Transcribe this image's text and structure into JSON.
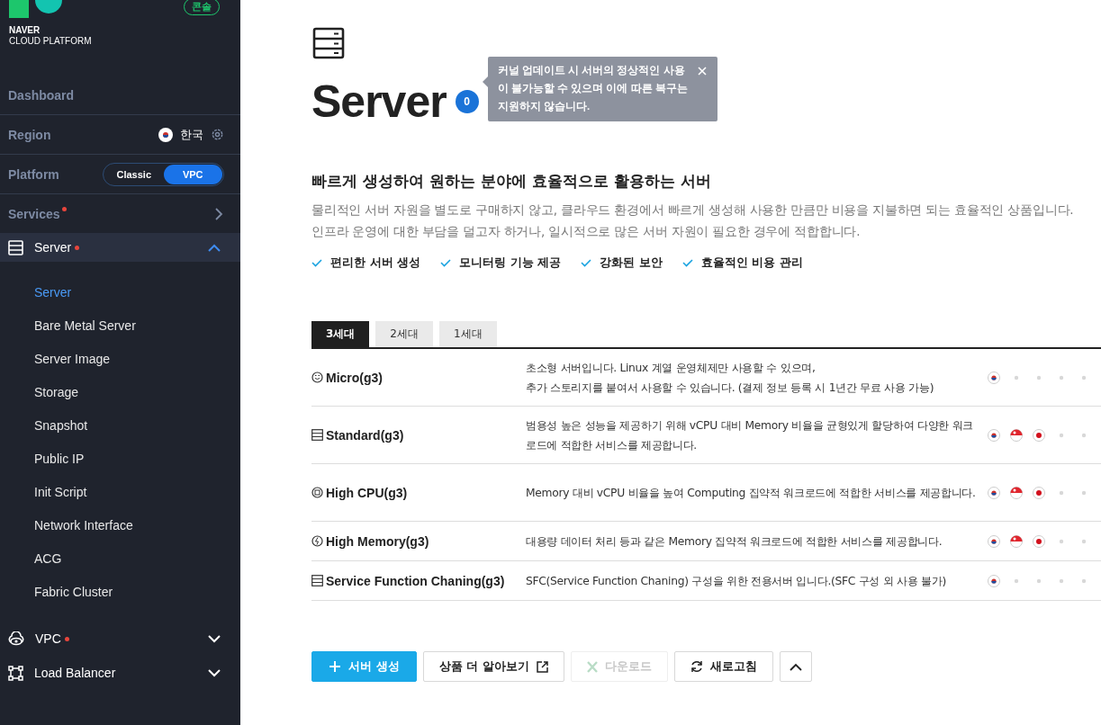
{
  "sidebar": {
    "logo": {
      "line1": "NAVER",
      "line2": "CLOUD PLATFORM"
    },
    "console_badge": "콘솔",
    "dashboard": "Dashboard",
    "region": {
      "label": "Region",
      "value": "한국"
    },
    "platform": {
      "label": "Platform",
      "options": [
        {
          "label": "Classic",
          "selected": false
        },
        {
          "label": "VPC",
          "selected": true
        }
      ]
    },
    "services": {
      "label": "Services",
      "new": true
    },
    "groups": [
      {
        "label": "Server",
        "kind": "server",
        "new": true,
        "expanded": true,
        "items": [
          {
            "label": "Server",
            "selected": true
          },
          {
            "label": "Bare Metal Server",
            "selected": false
          },
          {
            "label": "Server Image",
            "selected": false
          },
          {
            "label": "Storage",
            "selected": false
          },
          {
            "label": "Snapshot",
            "selected": false
          },
          {
            "label": "Public IP",
            "selected": false
          },
          {
            "label": "Init Script",
            "selected": false
          },
          {
            "label": "Network Interface",
            "selected": false
          },
          {
            "label": "ACG",
            "selected": false
          },
          {
            "label": "Fabric Cluster",
            "selected": false
          }
        ]
      },
      {
        "label": "VPC",
        "kind": "vpc",
        "new": true,
        "expanded": false
      },
      {
        "label": "Load Balancer",
        "kind": "lb",
        "new": false,
        "expanded": false
      }
    ]
  },
  "header": {
    "title": "Server",
    "badge": "0",
    "tooltip": "커널 업데이트 시 서버의 정상적인 사용이 불가능할 수 있으며 이에 따른 복구는 지원하지 않습니다."
  },
  "intro": {
    "heading": "빠르게 생성하여 원하는 분야에 효율적으로 활용하는 서버",
    "lines": [
      "물리적인 서버 자원을 별도로 구매하지 않고, 클라우드 환경에서 빠르게 생성해 사용한 만큼만 비용을 지불하면 되는 효율적인 상품입니다.",
      "인프라 운영에 대한 부담을 덜고자 하거나, 일시적으로 많은 서버 자원이 필요한 경우에 적합합니다."
    ],
    "features": [
      "편리한 서버 생성",
      "모니터링 기능 제공",
      "강화된 보안",
      "효율적인 비용 관리"
    ]
  },
  "tabs": [
    {
      "label": "3세대",
      "selected": true
    },
    {
      "label": "2세대",
      "selected": false
    },
    {
      "label": "1세대",
      "selected": false
    }
  ],
  "rows": [
    {
      "kind": "micro",
      "name": "Micro(g3)",
      "description": "초소형 서버입니다. Linux 계열 운영체제만 사용할 수 있으며,\n추가 스토리지를 붙여서 사용할 수 있습니다. (결제 정보 등록 시 1년간 무료 사용 가능)",
      "regions": [
        {
          "kind": "kr"
        },
        {
          "kind": "none"
        },
        {
          "kind": "none"
        },
        {
          "kind": "none"
        },
        {
          "kind": "none"
        }
      ]
    },
    {
      "kind": "standard",
      "name": "Standard(g3)",
      "description": "범용성 높은 성능을 제공하기 위해 vCPU 대비 Memory 비율을 균형있게 할당하여 다양한 워크로드에 적합한 서비스를 제공합니다.",
      "regions": [
        {
          "kind": "kr"
        },
        {
          "kind": "sg"
        },
        {
          "kind": "jp"
        },
        {
          "kind": "none"
        },
        {
          "kind": "none"
        }
      ]
    },
    {
      "kind": "cpu",
      "name": "High CPU(g3)",
      "description": "Memory 대비 vCPU 비율을 높여 Computing 집약적 워크로드에 적합한 서비스를 제공합니다.",
      "regions": [
        {
          "kind": "kr"
        },
        {
          "kind": "sg"
        },
        {
          "kind": "jp"
        },
        {
          "kind": "none"
        },
        {
          "kind": "none"
        }
      ]
    },
    {
      "kind": "memory",
      "name": "High Memory(g3)",
      "description": "대용량 데이터 처리 등과 같은 Memory 집약적 워크로드에 적합한 서비스를 제공합니다.",
      "regions": [
        {
          "kind": "kr"
        },
        {
          "kind": "sg"
        },
        {
          "kind": "jp"
        },
        {
          "kind": "none"
        },
        {
          "kind": "none"
        }
      ]
    },
    {
      "kind": "standard",
      "name": "Service Function Chaning(g3)",
      "description": "SFC(Service Function Chaning) 구성을 위한 전용서버 입니다.(SFC 구성 외 사용 불가)",
      "regions": [
        {
          "kind": "kr"
        },
        {
          "kind": "none"
        },
        {
          "kind": "none"
        },
        {
          "kind": "none"
        },
        {
          "kind": "none"
        }
      ]
    }
  ],
  "actions": [
    {
      "kind": "primary",
      "label": "서버 생성",
      "disabled": false
    },
    {
      "kind": "external",
      "label": "상품 더 알아보기",
      "disabled": false
    },
    {
      "kind": "download",
      "label": "다운로드",
      "disabled": true
    },
    {
      "kind": "refresh",
      "label": "새로고침",
      "disabled": false
    },
    {
      "kind": "collapse",
      "disabled": false
    }
  ]
}
